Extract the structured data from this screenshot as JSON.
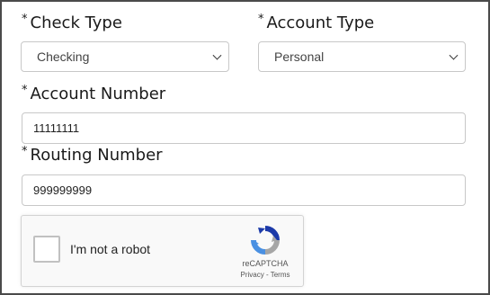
{
  "form": {
    "required_marker": "*",
    "check_type": {
      "label": "Check Type",
      "value": "Checking"
    },
    "account_type": {
      "label": "Account Type",
      "value": "Personal"
    },
    "account_number": {
      "label": "Account Number",
      "value": "11111111"
    },
    "routing_number": {
      "label": "Routing Number",
      "value": "999999999"
    }
  },
  "recaptcha": {
    "label": "I'm not a robot",
    "brand": "reCAPTCHA",
    "privacy": "Privacy",
    "separator": " - ",
    "terms": "Terms",
    "checked": false,
    "icon": "recaptcha-logo-icon",
    "colors": {
      "blue": "#4a90e2",
      "gray": "#a6a6a6",
      "dark_blue": "#1c3aa9"
    }
  },
  "icons": {
    "dropdown": "chevron-down-icon"
  }
}
